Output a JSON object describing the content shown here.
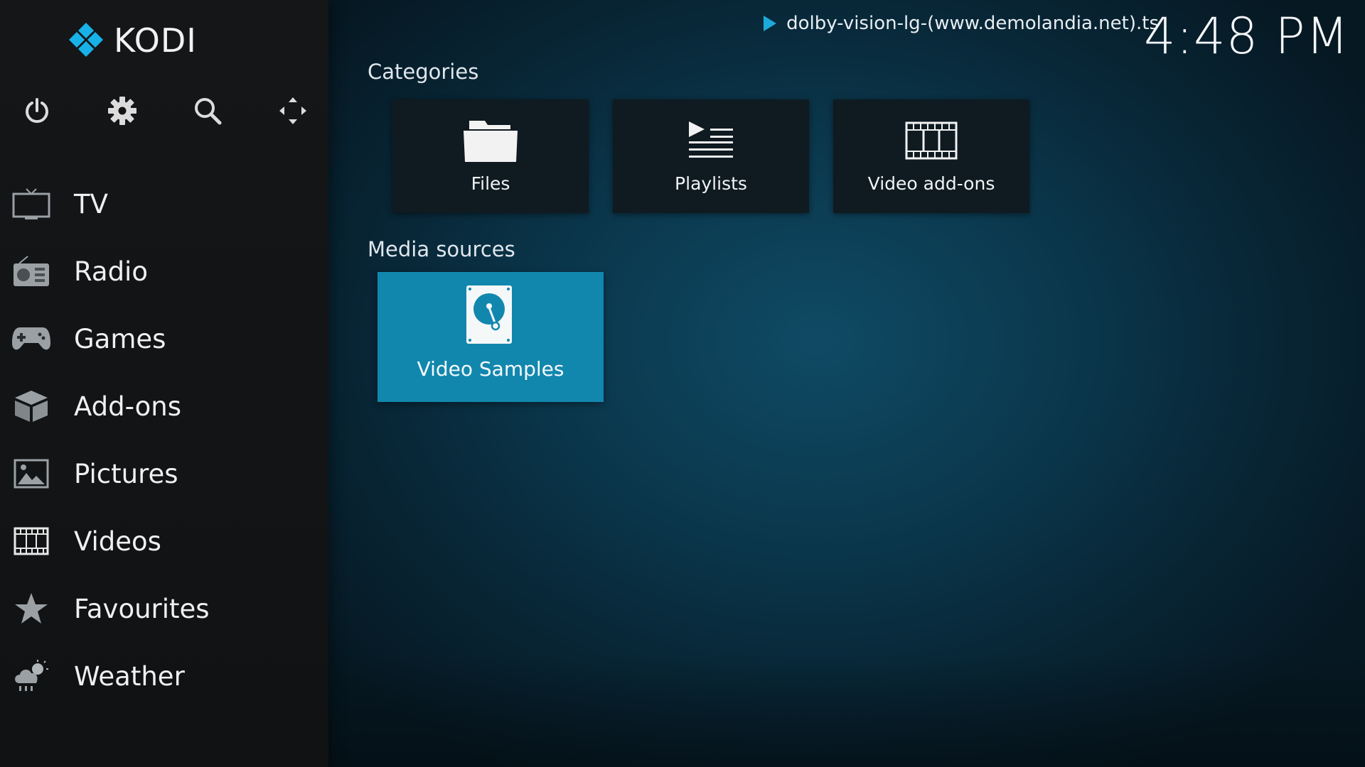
{
  "app": {
    "name": "KODI"
  },
  "top_icons": [
    {
      "name": "power-icon"
    },
    {
      "name": "gear-icon"
    },
    {
      "name": "search-icon"
    },
    {
      "name": "fullscreen-arrows-icon"
    }
  ],
  "nav": {
    "items": [
      {
        "label": "TV",
        "icon": "tv-icon"
      },
      {
        "label": "Radio",
        "icon": "radio-icon"
      },
      {
        "label": "Games",
        "icon": "gamepad-icon"
      },
      {
        "label": "Add-ons",
        "icon": "addons-box-icon"
      },
      {
        "label": "Pictures",
        "icon": "picture-icon"
      },
      {
        "label": "Videos",
        "icon": "film-icon"
      },
      {
        "label": "Favourites",
        "icon": "star-icon"
      },
      {
        "label": "Weather",
        "icon": "weather-icon"
      }
    ]
  },
  "header": {
    "now_playing": "dolby-vision-lg-(www.demolandia.net).ts",
    "clock": "4:48 PM"
  },
  "categories": {
    "title": "Categories",
    "tiles": [
      {
        "label": "Files",
        "icon": "folder-icon"
      },
      {
        "label": "Playlists",
        "icon": "playlist-icon"
      },
      {
        "label": "Video add-ons",
        "icon": "film-strip-icon"
      }
    ]
  },
  "media_sources": {
    "title": "Media sources",
    "tiles": [
      {
        "label": "Video Samples",
        "icon": "hard-drive-icon"
      }
    ]
  },
  "colors": {
    "accent": "#1287ae",
    "logo_blue": "#17b2e7",
    "sidebar_bg": "#131517",
    "main_bg": "#0b3a50"
  }
}
